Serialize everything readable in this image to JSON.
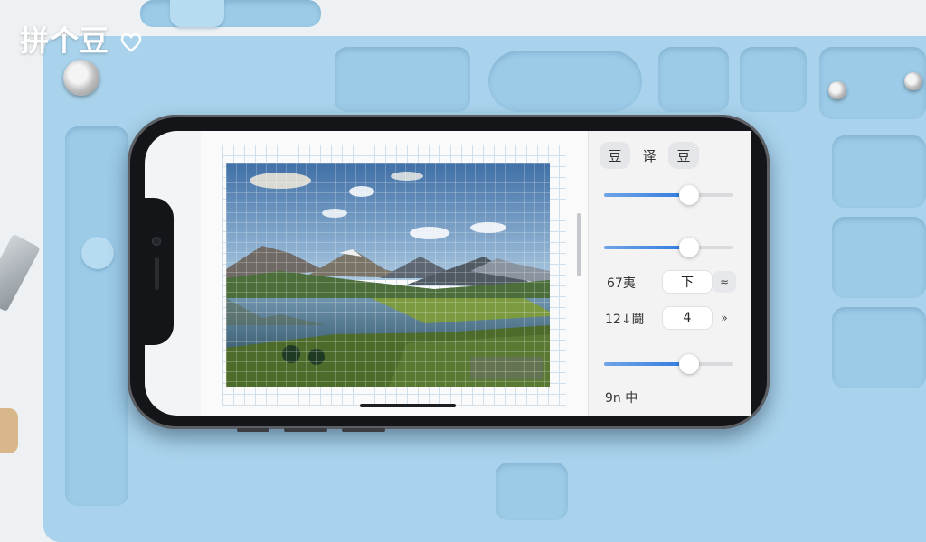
{
  "watermark": {
    "text": "拼个豆",
    "icon": "heart-icon"
  },
  "panel": {
    "chips": [
      "豆",
      "译",
      "豆"
    ],
    "sliders": [
      {
        "value": 0.66
      },
      {
        "value": 0.66
      },
      {
        "value": 0.66
      }
    ],
    "row1": {
      "label": "67夷",
      "value": "下",
      "btn_icon": "double-chevron-up-icon",
      "btn_glyph": "≈"
    },
    "row2": {
      "label": "12↓鬪",
      "value": "4",
      "btn_icon": "double-chevron-right-icon",
      "btn_glyph": "»"
    },
    "footer_label": "9n 中"
  },
  "colors": {
    "accent": "#2f7ae0",
    "mat": "#a9d3ec"
  }
}
